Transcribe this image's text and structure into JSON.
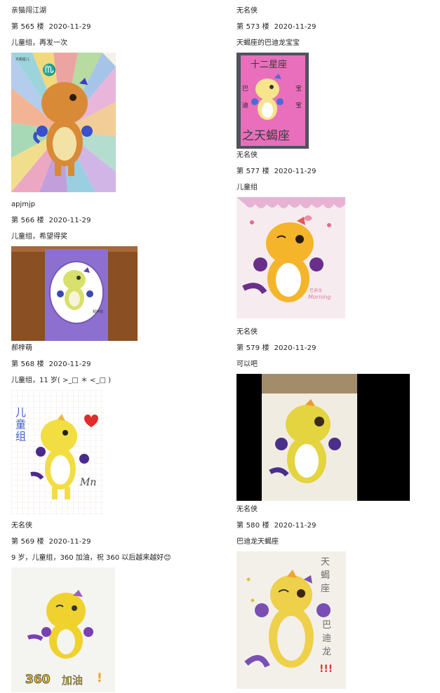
{
  "posts_left": [
    {
      "author": "亲猫闯江湖",
      "floor": "第 565 楼",
      "date": "2020-11-29",
      "text": "儿童组，再发一次",
      "image": "rainbow-dinosaur-drawing"
    },
    {
      "author": "apjmjp",
      "floor": "第 566 楼",
      "date": "2020-11-29",
      "text": "儿童组，希望得奖",
      "image": "purple-frame-dinosaur-drawing"
    },
    {
      "author": "郝梓萌",
      "floor": "第 568 楼",
      "date": "2020-11-29",
      "text": "儿童组，11 岁( >_□ ＊ <_□ )",
      "image": "grid-paper-dinosaur-drawing"
    },
    {
      "author": "无名侠",
      "floor": "第 569 楼",
      "date": "2020-11-29",
      "text": "9 岁，儿童组，360 加油，祝 360 以后越来越好😊",
      "image": "360-jiayou-dinosaur-drawing"
    }
  ],
  "posts_right": [
    {
      "author": "无名侠",
      "floor": "第 573 楼",
      "date": "2020-11-29",
      "text": "天蝎座的巴迪龙宝宝",
      "image": "pink-zodiac-dinosaur-drawing"
    },
    {
      "author": "无名侠",
      "floor": "第 577 楼",
      "date": "2020-11-29",
      "text": "儿童组",
      "image": "bow-dinosaur-drawing"
    },
    {
      "author": "无名侠",
      "floor": "第 579 楼",
      "date": "2020-11-29",
      "text": "可以吧",
      "image": "photo-dinosaur-drawing"
    },
    {
      "author": "无名侠",
      "floor": "第 580 楼",
      "date": "2020-11-29",
      "text": "巴迪龙天蝎座",
      "image": "scorpio-dinosaur-drawing"
    }
  ],
  "drawing_text": {
    "zodiac_title": "十二星座",
    "zodiac_left": "巴迪",
    "zodiac_right": "宝宝",
    "zodiac_bottom": "之天蝎座",
    "grid_side": "儿童组",
    "grid_sign": "Mn",
    "banner_360": "360",
    "banner_jiayou": "加油",
    "banner_bang": "!",
    "scorpio_side": "天蝎座",
    "scorpio_side2": "巴迪龙",
    "scorpio_bang": "!!!",
    "bow_caption": "巴迪龙",
    "bow_caption2": "Morning",
    "purple_caption": "郝梓萌",
    "rainbow_corner": "天蝎座儿"
  }
}
